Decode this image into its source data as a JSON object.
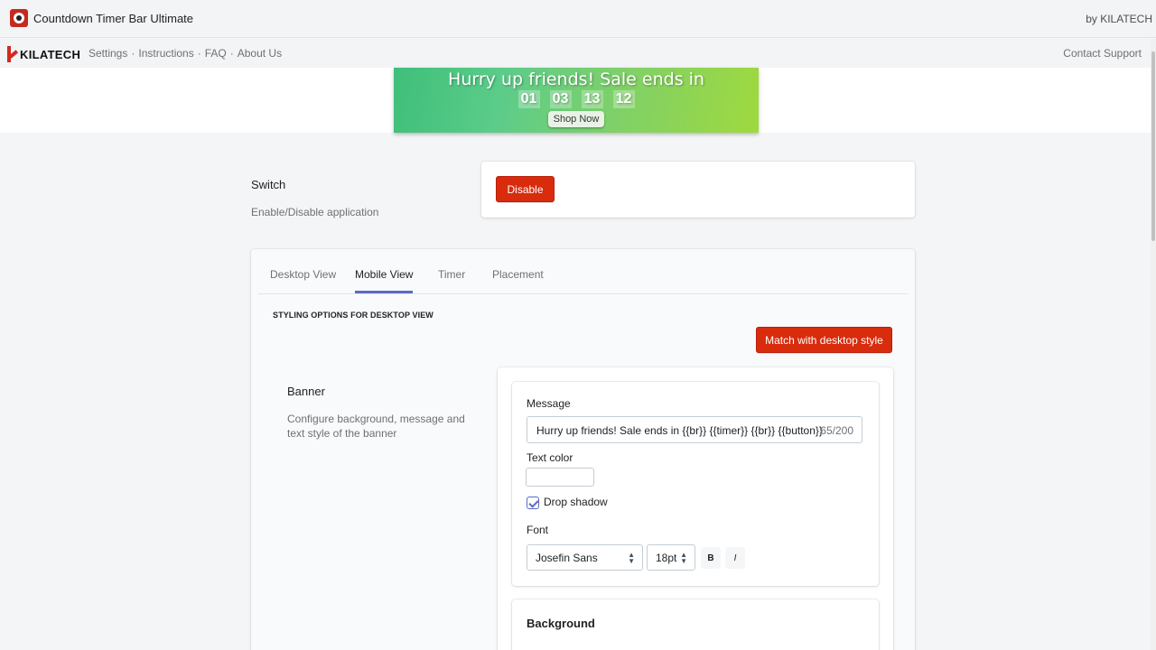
{
  "app": {
    "title": "Countdown Timer Bar Ultimate",
    "by": "by KILATECH"
  },
  "nav": {
    "brand": "KILATECH",
    "links": [
      "Settings",
      "Instructions",
      "FAQ",
      "About Us"
    ],
    "separator": "·",
    "contact": "Contact Support"
  },
  "preview": {
    "message": "Hurry up friends! Sale ends in",
    "timer": [
      "01",
      "03",
      "13",
      "12"
    ],
    "button": "Shop Now"
  },
  "switch": {
    "title": "Switch",
    "description": "Enable/Disable application",
    "button": "Disable"
  },
  "tabs": [
    "Desktop View",
    "Mobile View",
    "Timer",
    "Placement"
  ],
  "active_tab": "Mobile View",
  "section_heading": "STYLING OPTIONS FOR DESKTOP VIEW",
  "match_button": "Match with desktop style",
  "banner": {
    "title": "Banner",
    "description": "Configure background, message and text style of the banner"
  },
  "form": {
    "message_label": "Message",
    "message_value": "Hurry up friends! Sale ends in {{br}} {{timer}} {{br}} {{button}}",
    "message_count": "65/200",
    "text_color_label": "Text color",
    "drop_shadow_label": "Drop shadow",
    "drop_shadow_checked": true,
    "font_label": "Font",
    "font_value": "Josefin Sans",
    "size_value": "18pt",
    "bold_label": "B",
    "italic_label": "I"
  },
  "background": {
    "title": "Background"
  },
  "colors": {
    "accent": "#d82c0d",
    "tab_indicator": "#5c6ac4",
    "brand_red": "#d4291c"
  }
}
